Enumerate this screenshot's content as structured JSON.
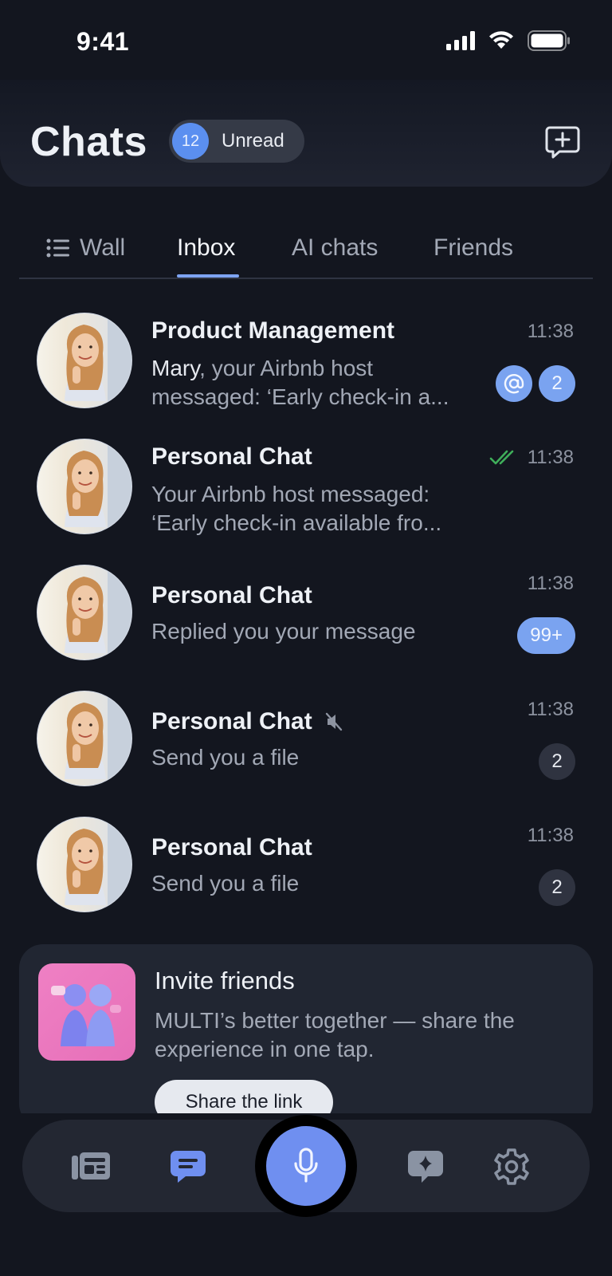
{
  "status_bar": {
    "time": "9:41"
  },
  "header": {
    "title": "Chats",
    "unread_count": "12",
    "unread_label": "Unread"
  },
  "tabs": [
    {
      "label": "Wall",
      "icon": "list-icon",
      "active": false
    },
    {
      "label": "Inbox",
      "active": true
    },
    {
      "label": "AI chats",
      "active": false
    },
    {
      "label": "Friends",
      "active": false
    }
  ],
  "chats": [
    {
      "name": "Product Management",
      "time": "11:38",
      "sender": "Mary",
      "preview_line1": ", your Airbnb host",
      "preview_line2": "messaged: ‘Early check-in a...",
      "mention_icon": "at-icon",
      "badge": "2"
    },
    {
      "name": "Personal Chat",
      "time": "11:38",
      "read_icon": "double-check-icon",
      "preview_line1": "Your Airbnb host messaged:",
      "preview_line2": "‘Early check-in available fro..."
    },
    {
      "name": "Personal Chat",
      "time": "11:38",
      "preview_line1": "Replied you your message",
      "badge": "99+"
    },
    {
      "name": "Personal Chat",
      "time": "11:38",
      "muted_icon": "mute-icon",
      "preview_line1": "Send you a file",
      "badge": "2"
    },
    {
      "name": "Personal Chat",
      "time": "11:38",
      "preview_line1": "Send you a file",
      "badge": "2"
    }
  ],
  "invite": {
    "title": "Invite friends",
    "text": "MULTI’s better together — share the experience in one tap.",
    "button": "Share the link"
  },
  "bottom_nav": [
    {
      "icon": "news-icon"
    },
    {
      "icon": "chats-icon",
      "active": true
    },
    {
      "icon": "microphone-icon"
    },
    {
      "icon": "ai-sparkle-icon"
    },
    {
      "icon": "settings-icon"
    }
  ],
  "colors": {
    "accent": "#7aa3f0",
    "background": "#13161f",
    "read_check": "#3fae5a"
  }
}
